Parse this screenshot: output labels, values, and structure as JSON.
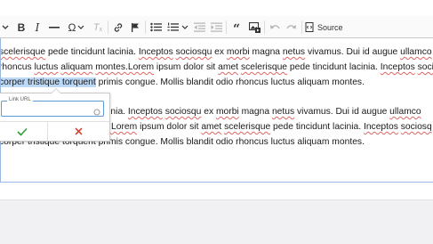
{
  "toolbar": {
    "source_label": "Source",
    "buttons": [
      "chevron-down-icon",
      "bold-icon",
      "italic-icon",
      "horizontal-line-icon",
      "special-characters-icon",
      "remove-format-icon",
      "link-icon",
      "anchor-flag-icon",
      "bulleted-list-icon",
      "numbered-list-icon",
      "outdent-icon",
      "indent-icon",
      "block-quote-icon",
      "insert-media-icon",
      "undo-icon",
      "redo-icon",
      "source-icon"
    ]
  },
  "editor": {
    "paragraph1": {
      "line1": [
        {
          "t": "scelerisque",
          "sq": true
        },
        {
          "t": " pede tincidunt lacinia. ",
          "sq": false
        },
        {
          "t": "Inceptos",
          "sq": true
        },
        {
          "t": " ",
          "sq": false
        },
        {
          "t": "sociosqu",
          "sq": true
        },
        {
          "t": " ex ",
          "sq": false
        },
        {
          "t": "morbi",
          "sq": true
        },
        {
          "t": " magna ",
          "sq": false
        },
        {
          "t": "netus",
          "sq": true
        },
        {
          "t": " vivamus. Dui id augue ",
          "sq": false
        },
        {
          "t": "ullamco",
          "sq": true
        }
      ],
      "line2": [
        {
          "t": "rhoncus ",
          "sq": false
        },
        {
          "t": "luctus",
          "sq": true
        },
        {
          "t": " ",
          "sq": false
        },
        {
          "t": "aliquam",
          "sq": true
        },
        {
          "t": " ",
          "sq": false
        },
        {
          "t": "montes.Lorem",
          "sq": true
        },
        {
          "t": " ipsum dolor sit ",
          "sq": false
        },
        {
          "t": "amet",
          "sq": true
        },
        {
          "t": " ",
          "sq": false
        },
        {
          "t": "scelerisque",
          "sq": true
        },
        {
          "t": " pede tincidunt lacinia. ",
          "sq": false
        },
        {
          "t": "Inceptos",
          "sq": true
        },
        {
          "t": " ",
          "sq": false
        },
        {
          "t": "sociosq",
          "sq": true
        }
      ],
      "line3_selected": "corper tristique torquent",
      "line3_rest": " primis congue. Mollis blandit odio rhoncus luctus aliquam montes."
    },
    "paragraph2": {
      "line1": [
        {
          "t": "cinia. ",
          "sq": false
        },
        {
          "t": "Inceptos",
          "sq": true
        },
        {
          "t": " ",
          "sq": false
        },
        {
          "t": "sociosqu",
          "sq": true
        },
        {
          "t": " ex ",
          "sq": false
        },
        {
          "t": "morbi",
          "sq": true
        },
        {
          "t": " magna ",
          "sq": false
        },
        {
          "t": "netus",
          "sq": true
        },
        {
          "t": " vivamus. Dui id augue ",
          "sq": false
        },
        {
          "t": "ullamco",
          "sq": true
        }
      ],
      "line2": [
        {
          "t": "s.Lorem",
          "sq": true
        },
        {
          "t": " ipsum dolor sit ",
          "sq": false
        },
        {
          "t": "amet",
          "sq": true
        },
        {
          "t": " ",
          "sq": false
        },
        {
          "t": "scelerisque",
          "sq": true
        },
        {
          "t": " pede tincidunt lacinia. ",
          "sq": false
        },
        {
          "t": "Inceptos",
          "sq": true
        },
        {
          "t": " ",
          "sq": false
        },
        {
          "t": "sociosq",
          "sq": true
        }
      ],
      "line3": "corper tristique torquent primis congue. Mollis blandit odio rhoncus luctus aliquam montes."
    }
  },
  "link_balloon": {
    "url_label": "Link URL",
    "url_value": "",
    "save_icon": "check-icon",
    "cancel_icon": "close-icon"
  },
  "colors": {
    "selection": "#bcd9f7",
    "save_green": "#2e9d3a",
    "cancel_red": "#d8351f",
    "focus_border": "#5f9ad8"
  }
}
